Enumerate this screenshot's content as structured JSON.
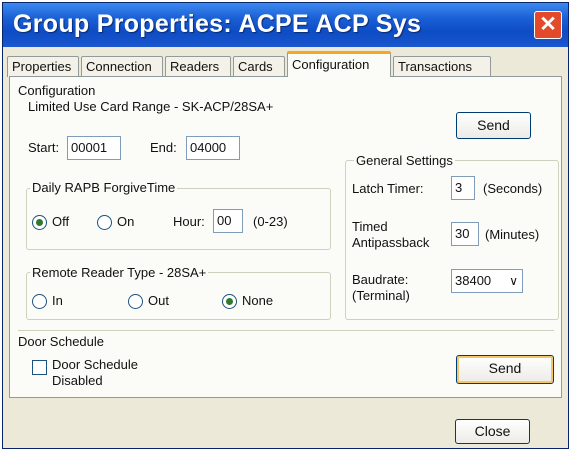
{
  "window": {
    "title": "Group Properties: ACPE ACP Sys",
    "close_glyph": "✕"
  },
  "tabs": [
    {
      "label": "Properties"
    },
    {
      "label": "Connection"
    },
    {
      "label": "Readers"
    },
    {
      "label": "Cards"
    },
    {
      "label": "Configuration"
    },
    {
      "label": "Transactions"
    }
  ],
  "active_tab": "Configuration",
  "configuration": {
    "section_title": "Configuration",
    "limited_use_label": "Limited Use Card Range - SK-ACP/28SA+",
    "start_label": "Start:",
    "start_value": "00001",
    "end_label": "End:",
    "end_value": "04000",
    "send_label": "Send"
  },
  "forgive": {
    "title": "Daily RAPB ForgiveTime",
    "off_label": "Off",
    "on_label": "On",
    "selected": "Off",
    "hour_label": "Hour:",
    "hour_value": "00",
    "hour_range": "(0-23)"
  },
  "remote_reader": {
    "title": "Remote Reader Type - 28SA+",
    "in_label": "In",
    "out_label": "Out",
    "none_label": "None",
    "selected": "None"
  },
  "general_settings": {
    "title": "General Settings",
    "latch_label": "Latch Timer:",
    "latch_value": "3",
    "latch_unit": "(Seconds)",
    "timed_label_1": "Timed",
    "timed_label_2": "Antipassback",
    "timed_value": "30",
    "timed_unit": "(Minutes)",
    "baud_label_1": "Baudrate:",
    "baud_label_2": "(Terminal)",
    "baud_value": "38400"
  },
  "door_schedule": {
    "title": "Door Schedule",
    "checkbox_label_1": "Door Schedule",
    "checkbox_label_2": "Disabled",
    "checked": false,
    "send_label": "Send"
  },
  "footer": {
    "close_label": "Close"
  },
  "colors": {
    "titlebar": "#1a5fd6",
    "close_button": "#e24a2a",
    "active_tab_accent": "#f5a623",
    "radio_dot": "#2f7a2f"
  },
  "icons": {
    "close": "close-icon",
    "dropdown": "chevron-down-icon"
  }
}
